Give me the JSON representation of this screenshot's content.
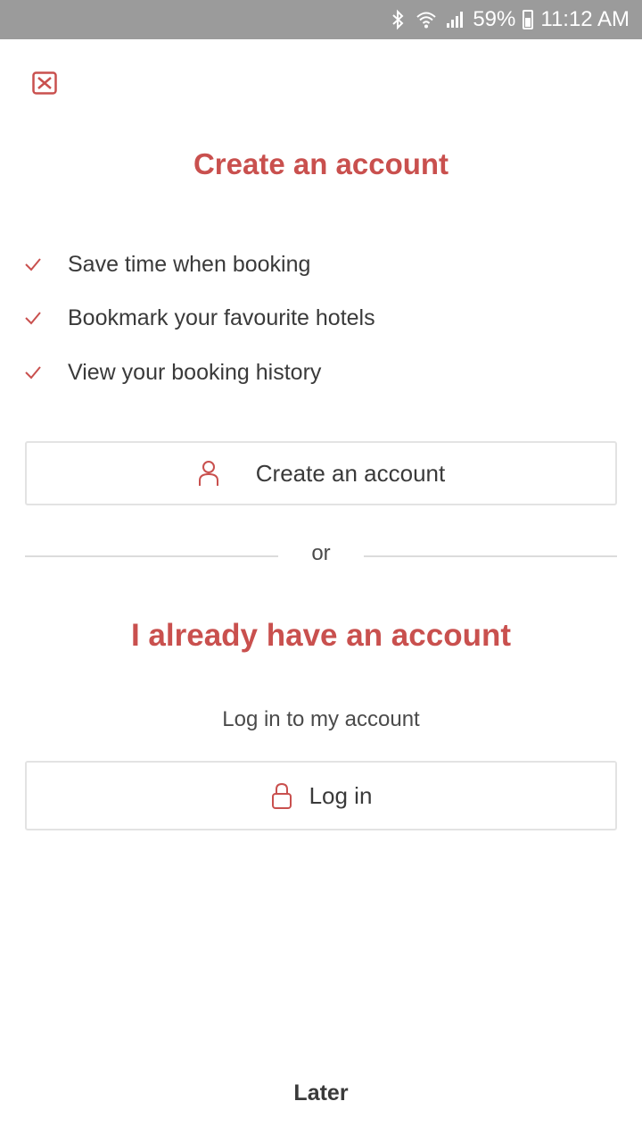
{
  "status_bar": {
    "battery": "59%",
    "time": "11:12 AM",
    "icons": [
      "bluetooth-icon",
      "wifi-icon",
      "signal-icon",
      "battery-icon"
    ]
  },
  "header": {
    "close_icon": "close-icon",
    "title": "Create an account"
  },
  "features": [
    {
      "icon": "checkmark-icon",
      "label": "Save time when booking"
    },
    {
      "icon": "checkmark-icon",
      "label": "Bookmark your favourite hotels"
    },
    {
      "icon": "checkmark-icon",
      "label": "View your booking history"
    }
  ],
  "create_button": {
    "icon": "person-icon",
    "label": "Create an account"
  },
  "divider": {
    "label": "or"
  },
  "login_section": {
    "title": "I already have an account",
    "hint": "Log in to my account",
    "button": {
      "icon": "lock-icon",
      "label": "Log in"
    }
  },
  "footer": {
    "later": "Later"
  },
  "colors": {
    "accent": "#c9504e",
    "text": "#3a3a3a",
    "status_bar": "#9b9b9b"
  }
}
